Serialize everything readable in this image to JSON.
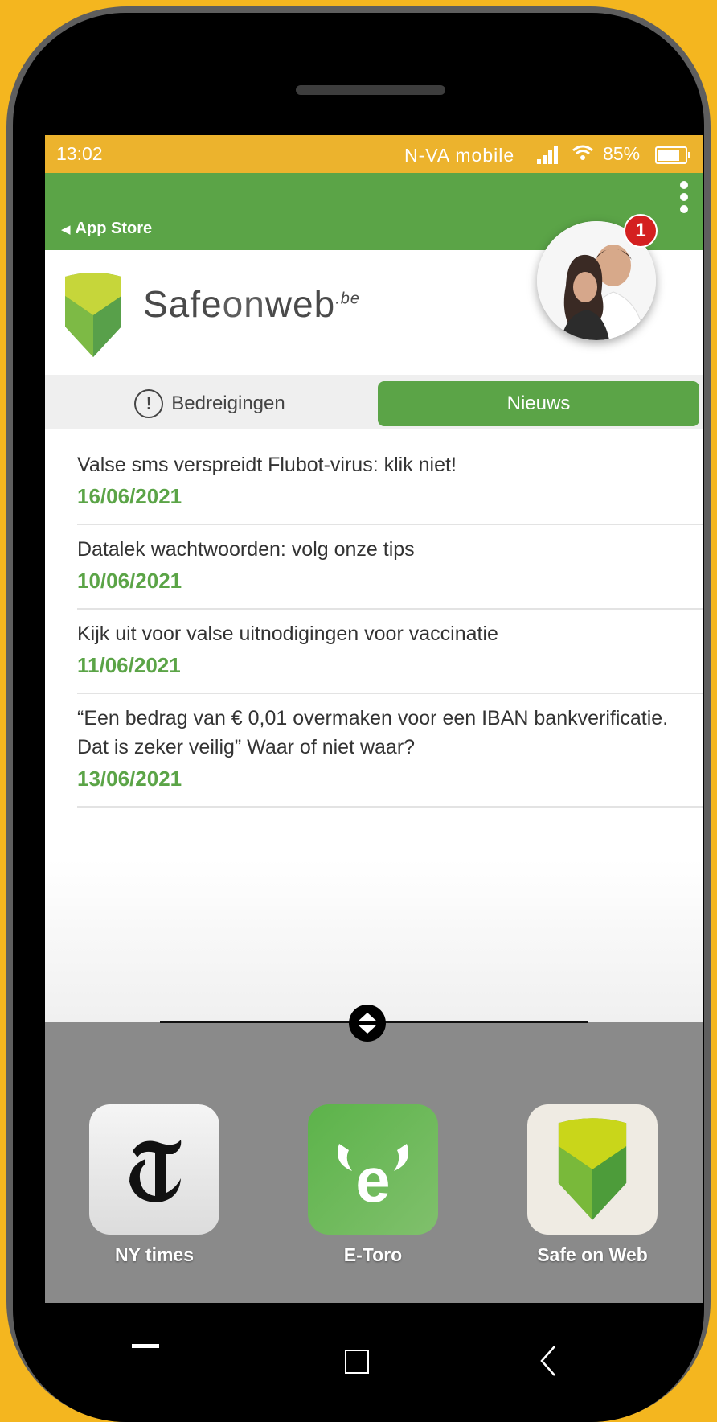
{
  "status_bar": {
    "time": "13:02",
    "carrier": "N-VA mobile",
    "battery": "85%",
    "battery_level": 0.85
  },
  "header": {
    "back_label": "App Store",
    "menu_icon": "kebab-menu-icon"
  },
  "brand": {
    "name_a": "Safe",
    "name_b": "on",
    "name_c": "web",
    "suffix": ".be"
  },
  "profile": {
    "badge_count": "1"
  },
  "tabs": [
    {
      "label": "Bedreigingen",
      "active": false
    },
    {
      "label": "Nieuws",
      "active": true
    }
  ],
  "news": [
    {
      "title": "Valse sms verspreidt Flubot-virus: klik niet!",
      "date": "16/06/2021"
    },
    {
      "title": "Datalek wachtwoorden: volg onze tips",
      "date": "10/06/2021"
    },
    {
      "title": "Kijk uit voor valse uitnodigingen voor vaccinatie",
      "date": "11/06/2021"
    },
    {
      "title": "“Een bedrag van € 0,01 overmaken voor een IBAN bankverificatie. Dat is zeker veilig” Waar of niet waar?",
      "date": "13/06/2021"
    }
  ],
  "dock": {
    "apps": [
      {
        "label": "NY times",
        "icon": "nytimes-icon"
      },
      {
        "label": "E-Toro",
        "icon": "etoro-icon"
      },
      {
        "label": "Safe on Web",
        "icon": "safeonweb-icon"
      }
    ]
  },
  "colors": {
    "background": "#f4b61f",
    "status_bar": "#ecb32d",
    "accent_green": "#5ba447",
    "drawer": "#8a8a8a",
    "badge": "#d42020"
  }
}
